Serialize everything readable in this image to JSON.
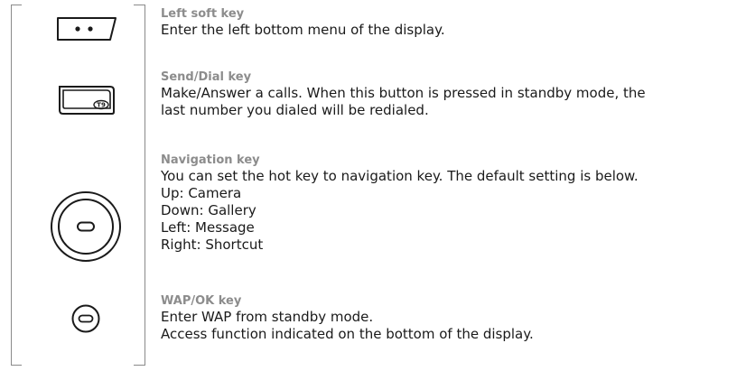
{
  "entries": [
    {
      "title": "Left soft key",
      "lines": [
        "Enter the left bottom menu of the display."
      ]
    },
    {
      "title": "Send/Dial key",
      "lines": [
        "Make/Answer a calls. When this button is pressed in standby mode, the",
        "last number you dialed will be redialed."
      ]
    },
    {
      "title": "Navigation key",
      "lines": [
        "You can set the hot key to navigation key. The default setting is below.",
        "Up: Camera",
        "Down: Gallery",
        "Left: Message",
        "Right: Shortcut"
      ]
    },
    {
      "title": "WAP/OK key",
      "lines": [
        "Enter WAP from standby mode.",
        "Access function indicated on the bottom of the display."
      ]
    }
  ],
  "icons": {
    "send_key_label": "T9"
  }
}
